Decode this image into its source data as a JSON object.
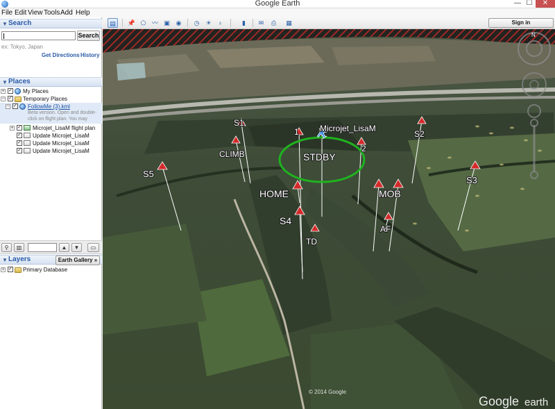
{
  "window": {
    "title": "Google Earth",
    "min": "—",
    "max": "☐",
    "close": "✕"
  },
  "menu": [
    "File",
    "Edit",
    "View",
    "Tools",
    "Add",
    "Help"
  ],
  "search": {
    "header": "Search",
    "input_value": "",
    "button": "Search",
    "hint": "ex: Tokyo, Japan",
    "get_directions": "Get Directions",
    "history": "History"
  },
  "places": {
    "header": "Places",
    "items": [
      {
        "label": "My Places"
      },
      {
        "label": "Temporary Places"
      },
      {
        "label": "FollowMe (3).kml",
        "description": [
          "Beta version. Open and double-",
          "click on flight plan. You may"
        ]
      },
      {
        "label": "Microjet_LisaM flight plan"
      },
      {
        "label": "Update Microjet_LisaM"
      },
      {
        "label": "Update Microjet_LisaM"
      },
      {
        "label": "Update Microjet_LisaM"
      }
    ]
  },
  "layers": {
    "header": "Layers",
    "gallery_button": "Earth Gallery  »",
    "items": [
      {
        "label": "Primary Database"
      }
    ]
  },
  "toolbar": {
    "signin": "Sign in",
    "icons": [
      "sidebar-toggle-icon",
      "placemark-icon",
      "polygon-icon",
      "path-icon",
      "image-overlay-icon",
      "record-tour-icon",
      "historical-imagery-icon",
      "sunlight-icon",
      "planets-icon",
      "ruler-icon",
      "email-icon",
      "print-icon",
      "google-maps-icon"
    ]
  },
  "map": {
    "copyright": "© 2014 Google",
    "watermark_google": "Google",
    "watermark_earth": "earth",
    "compass_north": "N",
    "aircraft_label": "Microjet_LisaM",
    "standby_label": "STDBY",
    "waypoints": [
      {
        "name": "S1"
      },
      {
        "name": "1"
      },
      {
        "name": "2"
      },
      {
        "name": "S2"
      },
      {
        "name": "CLIMB"
      },
      {
        "name": "S5"
      },
      {
        "name": "HOME"
      },
      {
        "name": "S4"
      },
      {
        "name": "TD"
      },
      {
        "name": "MOB"
      },
      {
        "name": "AF"
      },
      {
        "name": "S3"
      }
    ],
    "colors": {
      "waypoint": "#d42a2a",
      "standby_circle": "#1fb31f",
      "aircraft": "#3a8ee8"
    }
  }
}
